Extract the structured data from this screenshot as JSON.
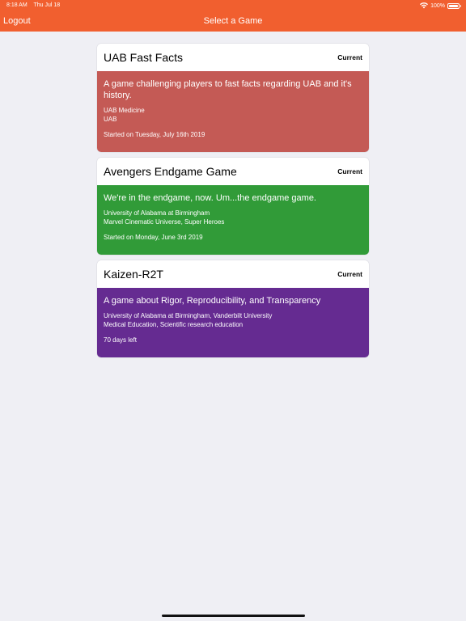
{
  "status": {
    "time": "8:18 AM",
    "date": "Thu Jul 18",
    "battery": "100%"
  },
  "nav": {
    "logout_label": "Logout",
    "title": "Select a Game"
  },
  "games": [
    {
      "title": "UAB Fast Facts",
      "badge": "Current",
      "color": "#c45a55",
      "description": "A game challenging players to fast facts regarding UAB and it's history.",
      "organizations": "UAB Medicine",
      "topics": "UAB",
      "date": "Started on Tuesday, July 16th 2019"
    },
    {
      "title": "Avengers Endgame Game",
      "badge": "Current",
      "color": "#319b38",
      "description": "We're in the endgame, now. Um...the endgame game.",
      "organizations": "University of Alabama at Birmingham",
      "topics": "Marvel Cinematic Universe, Super Heroes",
      "date": "Started on Monday, June 3rd 2019"
    },
    {
      "title": "Kaizen-R2T",
      "badge": "Current",
      "color": "#652b91",
      "description": "A game about Rigor, Reproducibility, and Transparency",
      "organizations": "University of Alabama at Birmingham, Vanderbilt University",
      "topics": "Medical Education, Scientific research education",
      "date": "70 days left"
    }
  ]
}
